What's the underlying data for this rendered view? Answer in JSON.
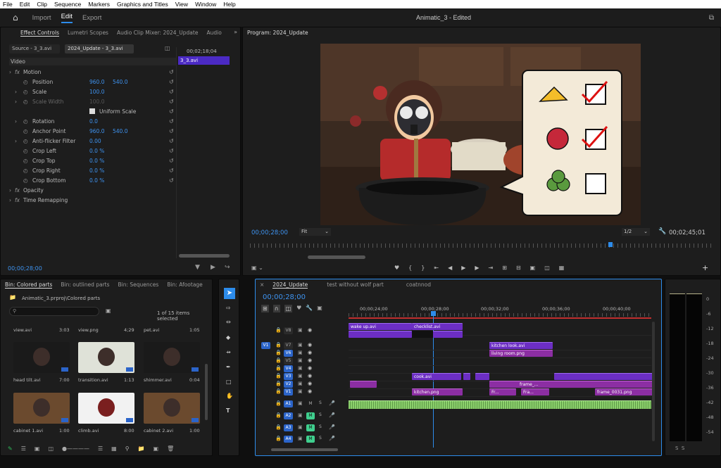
{
  "menu": [
    "File",
    "Edit",
    "Clip",
    "Sequence",
    "Markers",
    "Graphics and Titles",
    "View",
    "Window",
    "Help"
  ],
  "workspaces": {
    "import": "Import",
    "edit": "Edit",
    "export": "Export"
  },
  "doc_title": "Animatic_3 - Edited",
  "effect_panel": {
    "tabs": [
      "Effect Controls",
      "Lumetri Scopes",
      "Audio Clip Mixer: 2024_Update",
      "Audio"
    ],
    "source_tab": "Source - 3_3.avi",
    "seq_tab": "2024_Update - 3_3.avi",
    "mini_time": "00;02;18;04",
    "mini_clip": "3_3.avi",
    "video_label": "Video",
    "timecode": "00;00;28;00",
    "rows": [
      {
        "label": "Motion",
        "v1": "",
        "v2": ""
      },
      {
        "label": "Position",
        "v1": "960.0",
        "v2": "540.0"
      },
      {
        "label": "Scale",
        "v1": "100.0",
        "v2": ""
      },
      {
        "label": "Scale Width",
        "v1": "100.0",
        "v2": ""
      },
      {
        "label": "Uniform Scale",
        "v1": "",
        "v2": ""
      },
      {
        "label": "Rotation",
        "v1": "0.0",
        "v2": ""
      },
      {
        "label": "Anchor Point",
        "v1": "960.0",
        "v2": "540.0"
      },
      {
        "label": "Anti-flicker Filter",
        "v1": "0.00",
        "v2": ""
      },
      {
        "label": "Crop Left",
        "v1": "0.0 %",
        "v2": ""
      },
      {
        "label": "Crop Top",
        "v1": "0.0 %",
        "v2": ""
      },
      {
        "label": "Crop Right",
        "v1": "0.0 %",
        "v2": ""
      },
      {
        "label": "Crop Bottom",
        "v1": "0.0 %",
        "v2": ""
      },
      {
        "label": "Opacity",
        "v1": "",
        "v2": ""
      },
      {
        "label": "Time Remapping",
        "v1": "",
        "v2": ""
      }
    ]
  },
  "program": {
    "tab": "Program: 2024_Update",
    "time_left": "00;00;28;00",
    "fit": "Fit",
    "resolution": "1/2",
    "time_right": "00;02;45;01"
  },
  "bin": {
    "tabs": [
      "Bin: Colored parts",
      "Bin: outlined parts",
      "Bin: Sequences",
      "Bin: Afootage"
    ],
    "path": "Animatic_3.prproj\\Colored parts",
    "count": "1 of 15 items selected",
    "top_items": [
      {
        "name": "view.avi",
        "dur": "3:03"
      },
      {
        "name": "view.png",
        "dur": "4;29"
      },
      {
        "name": "pet.avi",
        "dur": "1:05"
      }
    ],
    "items": [
      {
        "name": "head tilt.avi",
        "dur": "7:00"
      },
      {
        "name": "transition.avi",
        "dur": "1:13"
      },
      {
        "name": "shimmer.avi",
        "dur": "0:04"
      },
      {
        "name": "cabinet 1.avi",
        "dur": "1:00"
      },
      {
        "name": "climb.avi",
        "dur": "8:00"
      },
      {
        "name": "cabinet 2.avi",
        "dur": "1:00"
      }
    ]
  },
  "timeline": {
    "tabs": [
      "2024_Update",
      "test without wolf part",
      "coatnnod"
    ],
    "timecode": "00;00;28;00",
    "ruler": [
      "00;00;24;00",
      "00;00;28;00",
      "00;00;32;00",
      "00;00;36;00",
      "00;00;40;00"
    ],
    "video_tracks": [
      "V8",
      "V7",
      "V6",
      "V5",
      "V4",
      "V3",
      "V2",
      "V1"
    ],
    "audio_tracks": [
      "A1",
      "A2",
      "A3",
      "A4"
    ],
    "src_patch": "V1",
    "clips": {
      "wake_up": "wake up.avi",
      "checklist": "checklist.avi",
      "kitchen_look": "kitchen look.avi",
      "living_room": "living room.png",
      "cook": "cook.avi",
      "kitchen_png": "kitchen.png",
      "frame1": "frame_...",
      "fr1": "Fr...",
      "fra": "Fra...",
      "frame31": "frame_0031.png"
    }
  },
  "meter": {
    "scale": [
      "0",
      "-6",
      "-12",
      "-18",
      "-24",
      "-30",
      "-36",
      "-42",
      "-48",
      "-54"
    ],
    "bottom": "S  S"
  }
}
